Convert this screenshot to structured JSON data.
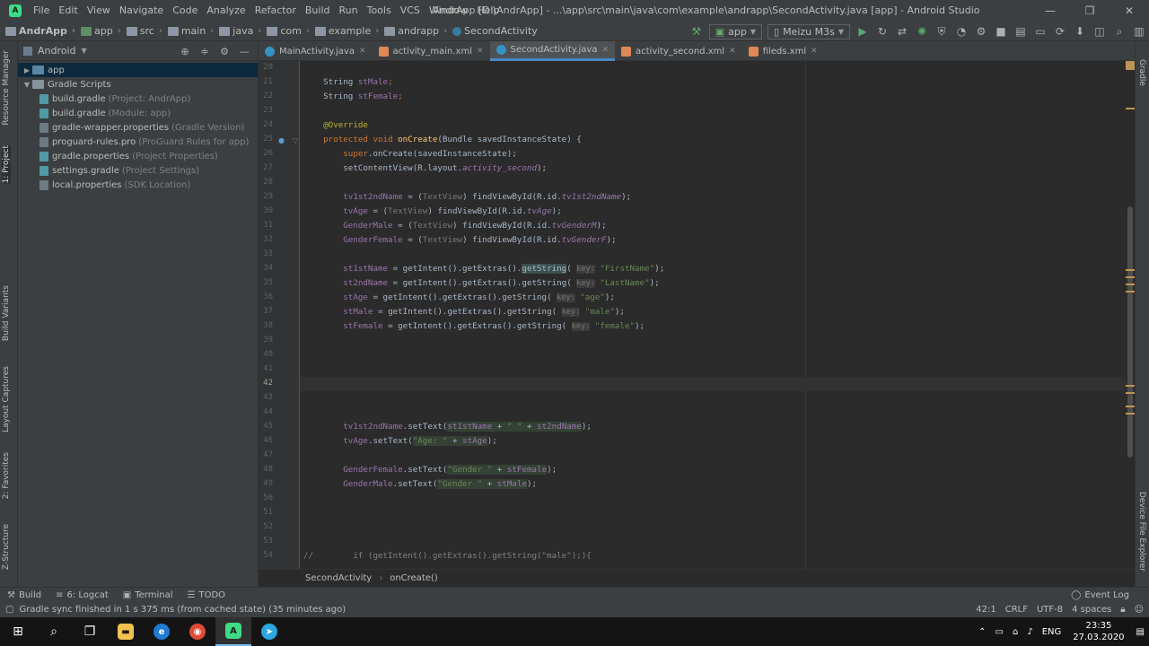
{
  "window": {
    "title": "AndrApp [D:\\AndrApp] - ...\\app\\src\\main\\java\\com\\example\\andrapp\\SecondActivity.java [app] - Android Studio",
    "controls": [
      "—",
      "❐",
      "✕"
    ]
  },
  "menu": [
    "File",
    "Edit",
    "View",
    "Navigate",
    "Code",
    "Analyze",
    "Refactor",
    "Build",
    "Run",
    "Tools",
    "VCS",
    "Window",
    "Help"
  ],
  "navbar": {
    "breadcrumbs": [
      "AndrApp",
      "app",
      "src",
      "main",
      "java",
      "com",
      "example",
      "andrapp",
      "SecondActivity"
    ],
    "run_config": "app",
    "device": "Meizu M3s"
  },
  "left_tool_tabs": [
    "Resource Manager",
    "1: Project",
    "Build Variants",
    "Layout Captures",
    "2: Favorites",
    "Z-Structure"
  ],
  "right_tool_tabs": [
    "Gradle",
    "Device File Explorer"
  ],
  "project_panel": {
    "view_mode": "Android",
    "tree": [
      {
        "label": "app",
        "hint": "",
        "level": 0,
        "type": "module",
        "expanded": false
      },
      {
        "label": "Gradle Scripts",
        "hint": "",
        "level": 0,
        "type": "folder",
        "expanded": true
      },
      {
        "label": "build.gradle",
        "hint": "(Project: AndrApp)",
        "level": 1,
        "type": "gradle"
      },
      {
        "label": "build.gradle",
        "hint": "(Module: app)",
        "level": 1,
        "type": "gradle"
      },
      {
        "label": "gradle-wrapper.properties",
        "hint": "(Gradle Version)",
        "level": 1,
        "type": "file"
      },
      {
        "label": "proguard-rules.pro",
        "hint": "(ProGuard Rules for app)",
        "level": 1,
        "type": "file"
      },
      {
        "label": "gradle.properties",
        "hint": "(Project Properties)",
        "level": 1,
        "type": "gradle"
      },
      {
        "label": "settings.gradle",
        "hint": "(Project Settings)",
        "level": 1,
        "type": "gradle"
      },
      {
        "label": "local.properties",
        "hint": "(SDK Location)",
        "level": 1,
        "type": "file"
      }
    ]
  },
  "editor_tabs": [
    {
      "label": "MainActivity.java",
      "kind": "java",
      "active": false
    },
    {
      "label": "activity_main.xml",
      "kind": "xml",
      "active": false
    },
    {
      "label": "SecondActivity.java",
      "kind": "java",
      "active": true
    },
    {
      "label": "activity_second.xml",
      "kind": "xml",
      "active": false
    },
    {
      "label": "fileds.xml",
      "kind": "xml",
      "active": false
    }
  ],
  "code": {
    "current_line": 42,
    "lines": [
      {
        "n": 20,
        "tokens": []
      },
      {
        "n": 21,
        "tokens": [
          [
            "    String ",
            "p"
          ],
          [
            "stMale",
            "f"
          ],
          [
            ";",
            "k"
          ]
        ]
      },
      {
        "n": 22,
        "tokens": [
          [
            "    String ",
            "p"
          ],
          [
            "stFemale",
            "f"
          ],
          [
            ";",
            "k"
          ]
        ]
      },
      {
        "n": 23,
        "tokens": []
      },
      {
        "n": 24,
        "tokens": [
          [
            "    @Override",
            "a"
          ]
        ]
      },
      {
        "n": 25,
        "tokens": [
          [
            "    protected void ",
            "k"
          ],
          [
            "onCreate",
            "m"
          ],
          [
            "(Bundle savedInstanceState) {",
            "p"
          ]
        ]
      },
      {
        "n": 26,
        "tokens": [
          [
            "        super",
            "k"
          ],
          [
            ".onCreate(savedInstanceState);",
            "p"
          ]
        ]
      },
      {
        "n": 27,
        "tokens": [
          [
            "        setContentView(R.layout.",
            "p"
          ],
          [
            "activity_second",
            "i"
          ],
          [
            ");",
            "p"
          ]
        ]
      },
      {
        "n": 28,
        "tokens": []
      },
      {
        "n": 29,
        "tokens": [
          [
            "        ",
            "p"
          ],
          [
            "tv1st2ndName",
            "f"
          ],
          [
            " = (",
            "p"
          ],
          [
            "TextView",
            "g"
          ],
          [
            ") findViewById(R.id.",
            "p"
          ],
          [
            "tv1st2ndName",
            "i"
          ],
          [
            ");",
            "p"
          ]
        ]
      },
      {
        "n": 30,
        "tokens": [
          [
            "        ",
            "p"
          ],
          [
            "tvAge",
            "f"
          ],
          [
            " = (",
            "p"
          ],
          [
            "TextView",
            "g"
          ],
          [
            ") findViewById(R.id.",
            "p"
          ],
          [
            "tvAge",
            "i"
          ],
          [
            ");",
            "p"
          ]
        ]
      },
      {
        "n": 31,
        "tokens": [
          [
            "        ",
            "p"
          ],
          [
            "GenderMale",
            "f"
          ],
          [
            " = (",
            "p"
          ],
          [
            "TextView",
            "g"
          ],
          [
            ") findViewById(R.id.",
            "p"
          ],
          [
            "tvGenderM",
            "i"
          ],
          [
            ");",
            "p"
          ]
        ]
      },
      {
        "n": 32,
        "tokens": [
          [
            "        ",
            "p"
          ],
          [
            "GenderFemale",
            "f"
          ],
          [
            " = (",
            "p"
          ],
          [
            "TextView",
            "g"
          ],
          [
            ") findViewById(R.id.",
            "p"
          ],
          [
            "tvGenderF",
            "i"
          ],
          [
            ");",
            "p"
          ]
        ]
      },
      {
        "n": 33,
        "tokens": []
      },
      {
        "n": 34,
        "tokens": [
          [
            "        ",
            "p"
          ],
          [
            "st1stName",
            "f"
          ],
          [
            " = getIntent().getExtras().",
            "p"
          ],
          [
            "getString",
            "h"
          ],
          [
            "( ",
            "p"
          ],
          [
            "key:",
            "hint"
          ],
          [
            " \"FirstName\"",
            "s"
          ],
          [
            ");",
            "p"
          ]
        ]
      },
      {
        "n": 35,
        "tokens": [
          [
            "        ",
            "p"
          ],
          [
            "st2ndName",
            "f"
          ],
          [
            " = getIntent().getExtras().getString( ",
            "p"
          ],
          [
            "key:",
            "hint"
          ],
          [
            " \"LastName\"",
            "s"
          ],
          [
            ");",
            "p"
          ]
        ]
      },
      {
        "n": 36,
        "tokens": [
          [
            "        ",
            "p"
          ],
          [
            "stAge",
            "f"
          ],
          [
            " = getIntent().getExtras().getString( ",
            "p"
          ],
          [
            "key:",
            "hint"
          ],
          [
            " \"age\"",
            "s"
          ],
          [
            ");",
            "p"
          ]
        ]
      },
      {
        "n": 37,
        "tokens": [
          [
            "        ",
            "p"
          ],
          [
            "stMale",
            "f"
          ],
          [
            " = getIntent().getExtras().getString( ",
            "p"
          ],
          [
            "key:",
            "hint"
          ],
          [
            " \"male\"",
            "s"
          ],
          [
            ");",
            "p"
          ]
        ]
      },
      {
        "n": 38,
        "tokens": [
          [
            "        ",
            "p"
          ],
          [
            "stFemale",
            "f"
          ],
          [
            " = getIntent().getExtras().getString( ",
            "p"
          ],
          [
            "key:",
            "hint"
          ],
          [
            " \"female\"",
            "s"
          ],
          [
            ");",
            "p"
          ]
        ]
      },
      {
        "n": 39,
        "tokens": []
      },
      {
        "n": 40,
        "tokens": []
      },
      {
        "n": 41,
        "tokens": []
      },
      {
        "n": 42,
        "tokens": []
      },
      {
        "n": 43,
        "tokens": []
      },
      {
        "n": 44,
        "tokens": []
      },
      {
        "n": 45,
        "tokens": [
          [
            "        ",
            "p"
          ],
          [
            "tv1st2ndName",
            "f"
          ],
          [
            ".setText(",
            "p"
          ],
          [
            "st1stName",
            "hf"
          ],
          [
            " + ",
            "hp"
          ],
          [
            "\" \"",
            "hs"
          ],
          [
            " + ",
            "hp"
          ],
          [
            "st2ndName",
            "hf"
          ],
          [
            ");",
            "p"
          ]
        ]
      },
      {
        "n": 46,
        "tokens": [
          [
            "        ",
            "p"
          ],
          [
            "tvAge",
            "f"
          ],
          [
            ".setText(",
            "p"
          ],
          [
            "\"Age: \"",
            "hs"
          ],
          [
            " + ",
            "hp"
          ],
          [
            "stAge",
            "hf"
          ],
          [
            ");",
            "p"
          ]
        ]
      },
      {
        "n": 47,
        "tokens": []
      },
      {
        "n": 48,
        "tokens": [
          [
            "        ",
            "p"
          ],
          [
            "GenderFemale",
            "f"
          ],
          [
            ".setText(",
            "p"
          ],
          [
            "\"Gender \"",
            "hs"
          ],
          [
            " + ",
            "hp"
          ],
          [
            "stFemale",
            "hf"
          ],
          [
            ");",
            "p"
          ]
        ]
      },
      {
        "n": 49,
        "tokens": [
          [
            "        ",
            "p"
          ],
          [
            "GenderMale",
            "f"
          ],
          [
            ".setText(",
            "p"
          ],
          [
            "\"Gender \"",
            "hs"
          ],
          [
            " + ",
            "hp"
          ],
          [
            "stMale",
            "hf"
          ],
          [
            ");",
            "p"
          ]
        ]
      },
      {
        "n": 50,
        "tokens": []
      },
      {
        "n": 51,
        "tokens": []
      },
      {
        "n": 52,
        "tokens": []
      },
      {
        "n": 53,
        "tokens": []
      },
      {
        "n": 54,
        "tokens": [
          [
            "//        if (getIntent().getExtras().getString(\"male\");){",
            "p"
          ]
        ]
      }
    ]
  },
  "code_breadcrumb": [
    "SecondActivity",
    "onCreate()"
  ],
  "tool_windows": {
    "left": [
      "Build",
      "6: Logcat",
      "Terminal",
      "TODO"
    ],
    "right": "Event Log"
  },
  "status": {
    "message": "Gradle sync finished in 1 s 375 ms (from cached state) (35 minutes ago)",
    "position": "42:1",
    "line_sep": "CRLF",
    "encoding": "UTF-8",
    "indent": "4 spaces"
  },
  "taskbar": {
    "lang": "ENG",
    "time": "23:35",
    "date": "27.03.2020"
  },
  "colors": {
    "keyword": "#cc7832",
    "field": "#9876aa",
    "method": "#ffc66d",
    "string": "#6a8759",
    "annotation": "#bbb529",
    "plain": "#a9b7c6",
    "hint": "#787878",
    "accent": "#4a88c7"
  }
}
